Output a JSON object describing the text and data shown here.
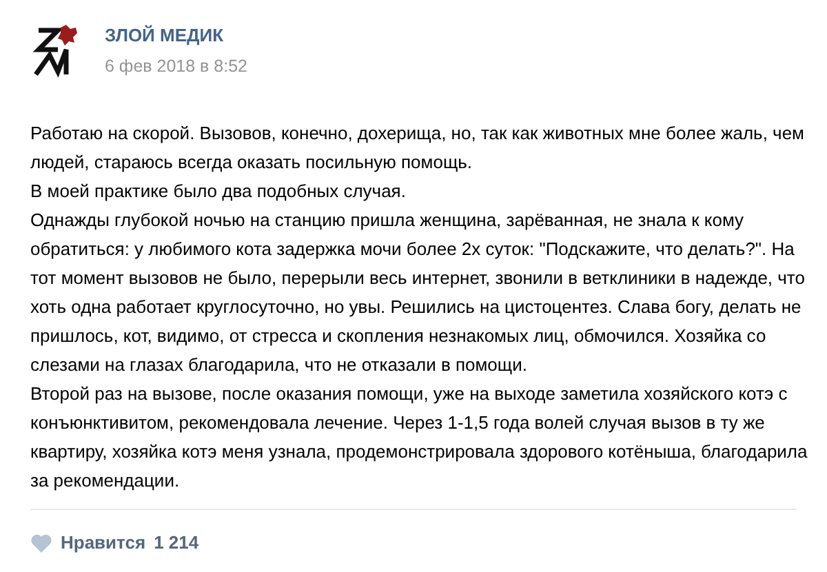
{
  "post": {
    "author": "ЗЛОЙ МЕДИК",
    "date": "6 фев 2018 в 8:52",
    "paragraphs": [
      "Работаю на скорой. Вызовов, конечно, дохерища, но, так как животных мне более жаль, чем людей, стараюсь всегда оказать посильную помощь.",
      "В моей практике было два подобных случая.",
      "Однажды глубокой ночью на станцию пришла женщина, зарёванная, не знала к кому обратиться: у любимого кота задержка мочи более 2х суток: \"Подскажите, что делать?\". На тот момент вызовов не было, перерыли весь интернет, звонили в ветклиники в надежде, что хоть одна работает круглосуточно, но увы. Решились на цистоцентез. Слава богу, делать не пришлось, кот, видимо, от стресса и скопления незнакомых лиц, обмочился. Хозяйка со слезами на глазах благодарила, что не отказали в помощи.",
      "Второй раз на вызове, после оказания помощи, уже на выходе заметила хозяйского котэ с конъюнктивитом, рекомендовала лечение. Через 1-1,5 года волей случая вызов в ту же квартиру, хозяйка котэ меня узнала, продемонстрировала здорового котёныша, благодарила за рекомендации."
    ],
    "like": {
      "label": "Нравится",
      "count": "1 214",
      "selected": false
    }
  }
}
